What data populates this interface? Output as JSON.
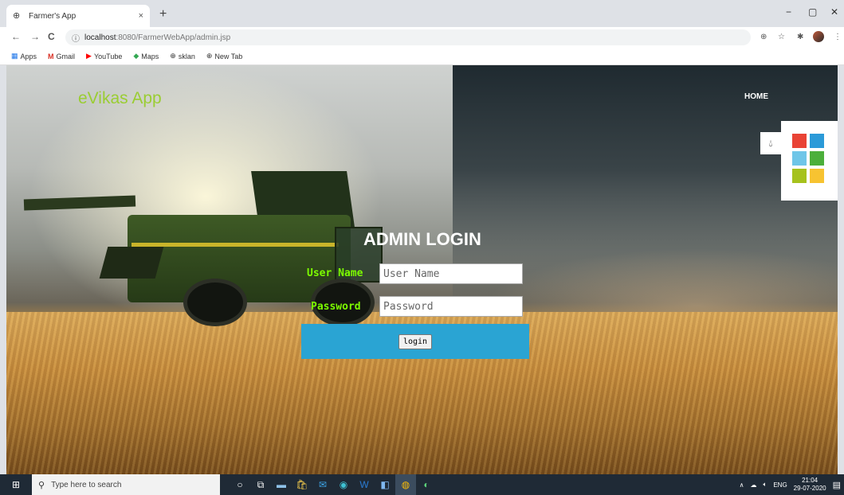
{
  "browser": {
    "tab_title": "Farmer's App",
    "tab_close": "×",
    "new_tab": "+",
    "url_host": "localhost",
    "url_path": ":8080/FarmerWebApp/admin.jsp",
    "window_controls": {
      "minimize": "−",
      "maximize": "▢",
      "close": "✕"
    },
    "nav": {
      "back": "←",
      "forward": "→",
      "reload": "C"
    },
    "bookmarks": [
      {
        "label": "Apps",
        "icon": "apps-grid-icon"
      },
      {
        "label": "Gmail",
        "icon": "gmail-icon"
      },
      {
        "label": "YouTube",
        "icon": "youtube-icon"
      },
      {
        "label": "Maps",
        "icon": "maps-icon"
      },
      {
        "label": "sklan",
        "icon": "globe-icon"
      },
      {
        "label": "New Tab",
        "icon": "globe-icon"
      }
    ]
  },
  "header": {
    "brand": "eVikas App",
    "nav_home": "HOME"
  },
  "theme_widget": {
    "toggle_icon": "water-drop-icon",
    "swatches": [
      "#e94335",
      "#2b9ad8",
      "#6fc6e8",
      "#4caf3b",
      "#a6c21d",
      "#f7c331"
    ]
  },
  "login": {
    "title": "ADMIN LOGIN",
    "username_label": "User Name",
    "username_placeholder": "User Name",
    "password_label": "Password",
    "password_placeholder": "Password",
    "submit_label": "login"
  },
  "taskbar": {
    "search_placeholder": "Type here to search",
    "language": "ENG",
    "time": "21:04",
    "date": "29-07-2020"
  }
}
